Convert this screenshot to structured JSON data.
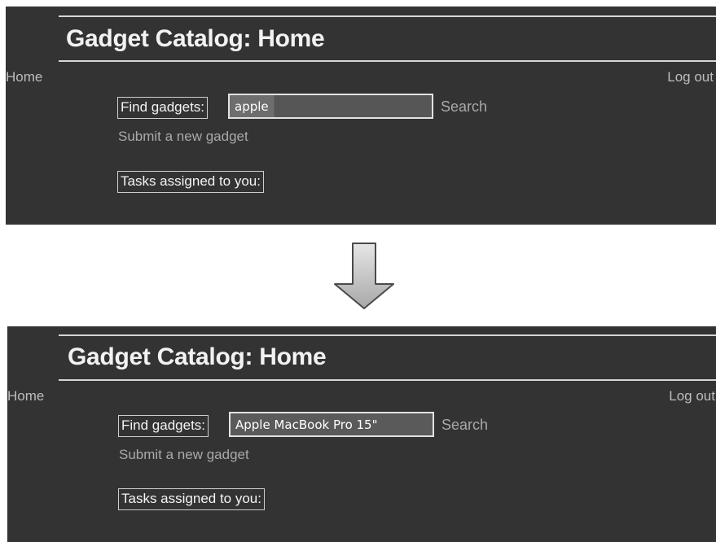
{
  "screens": [
    {
      "title": "Gadget Catalog: Home",
      "nav": {
        "home": "Home",
        "logout": "Log out"
      },
      "search": {
        "label": "Find gadgets:",
        "value": "apple",
        "button": "Search"
      },
      "submit_link": "Submit a new gadget",
      "tasks_label": "Tasks assigned to you:"
    },
    {
      "title": "Gadget Catalog: Home",
      "nav": {
        "home": "Home",
        "logout": "Log out"
      },
      "search": {
        "label": "Find gadgets:",
        "value": "Apple MacBook Pro 15\"",
        "button": "Search"
      },
      "submit_link": "Submit a new gadget",
      "tasks_label": "Tasks assigned to you:"
    }
  ],
  "transition_icon": "down-arrow-icon",
  "colors": {
    "panel_bg": "#333333",
    "text": "#e8e8e8",
    "muted_link": "#a9a9a9",
    "rule": "#d6d6d6"
  }
}
